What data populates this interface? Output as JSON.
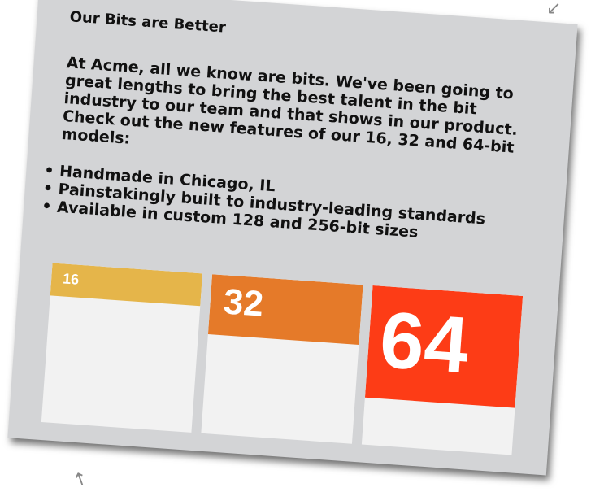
{
  "card": {
    "title": "Our Bits are Better",
    "intro": "At Acme, all we know are bits. We've been going to great lengths to bring the best talent in the bit industry to our team and that shows in our product. Check out the new features of our 16, 32 and 64-bit models:",
    "features": [
      "Handmade in Chicago, IL",
      "Painstakingly built to industry-leading standards",
      "Available in custom 128 and 256-bit sizes"
    ],
    "tiles": [
      {
        "label": "16",
        "color": "#e5b54a"
      },
      {
        "label": "32",
        "color": "#e57a29"
      },
      {
        "label": "64",
        "color": "#fd3c16"
      }
    ]
  },
  "decor": {
    "arrow_top_right": "arrow-down-left-icon",
    "arrow_bottom_left": "arrow-up-icon"
  }
}
